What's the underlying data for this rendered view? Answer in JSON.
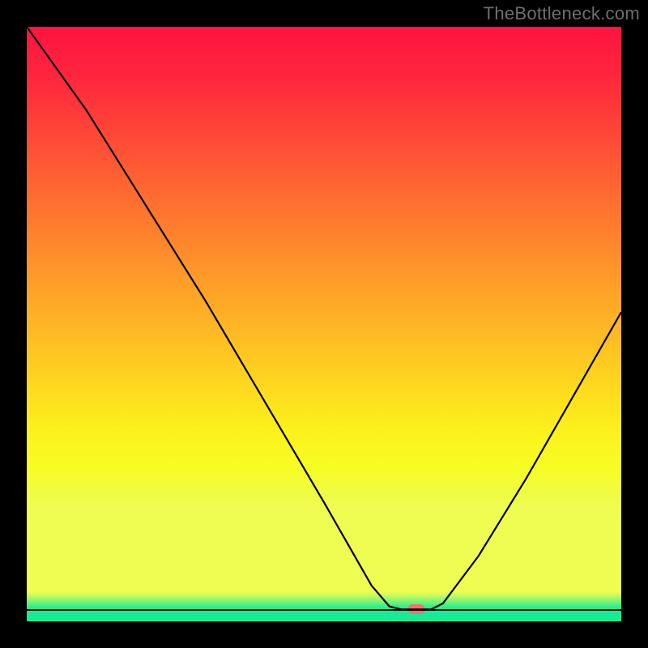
{
  "chart_data": {
    "type": "line",
    "watermark": "TheBottleneck.com",
    "x_range": [
      0,
      100
    ],
    "y_range": [
      0,
      100
    ],
    "baseline_y": 98,
    "marker": {
      "x": 65.5,
      "y": 98
    },
    "curve": [
      {
        "x": 0,
        "y": 0
      },
      {
        "x": 10,
        "y": 14
      },
      {
        "x": 20,
        "y": 30
      },
      {
        "x": 30,
        "y": 46
      },
      {
        "x": 40,
        "y": 63
      },
      {
        "x": 50,
        "y": 80
      },
      {
        "x": 58,
        "y": 94
      },
      {
        "x": 61,
        "y": 97.5
      },
      {
        "x": 63,
        "y": 98
      },
      {
        "x": 68,
        "y": 98
      },
      {
        "x": 70,
        "y": 97
      },
      {
        "x": 76,
        "y": 89
      },
      {
        "x": 84,
        "y": 76
      },
      {
        "x": 92,
        "y": 62
      },
      {
        "x": 100,
        "y": 48
      }
    ],
    "gradient_stops": [
      {
        "pct": 0,
        "color": "#fe1440"
      },
      {
        "pct": 8,
        "color": "#fe253d"
      },
      {
        "pct": 18,
        "color": "#fe4737"
      },
      {
        "pct": 28,
        "color": "#fe6a31"
      },
      {
        "pct": 38,
        "color": "#fe8c2b"
      },
      {
        "pct": 48,
        "color": "#feae26"
      },
      {
        "pct": 58,
        "color": "#fed020"
      },
      {
        "pct": 67,
        "color": "#fcee1c"
      },
      {
        "pct": 74,
        "color": "#f7fd23"
      },
      {
        "pct": 79,
        "color": "#effc46"
      },
      {
        "pct": 80.5,
        "color": "#effd52"
      },
      {
        "pct": 95,
        "color": "#effd52"
      },
      {
        "pct": 96,
        "color": "#d3fb5a"
      },
      {
        "pct": 97,
        "color": "#74f478"
      },
      {
        "pct": 98,
        "color": "#17eb95"
      },
      {
        "pct": 100,
        "color": "#17eb95"
      }
    ],
    "title": "",
    "xlabel": "",
    "ylabel": ""
  }
}
